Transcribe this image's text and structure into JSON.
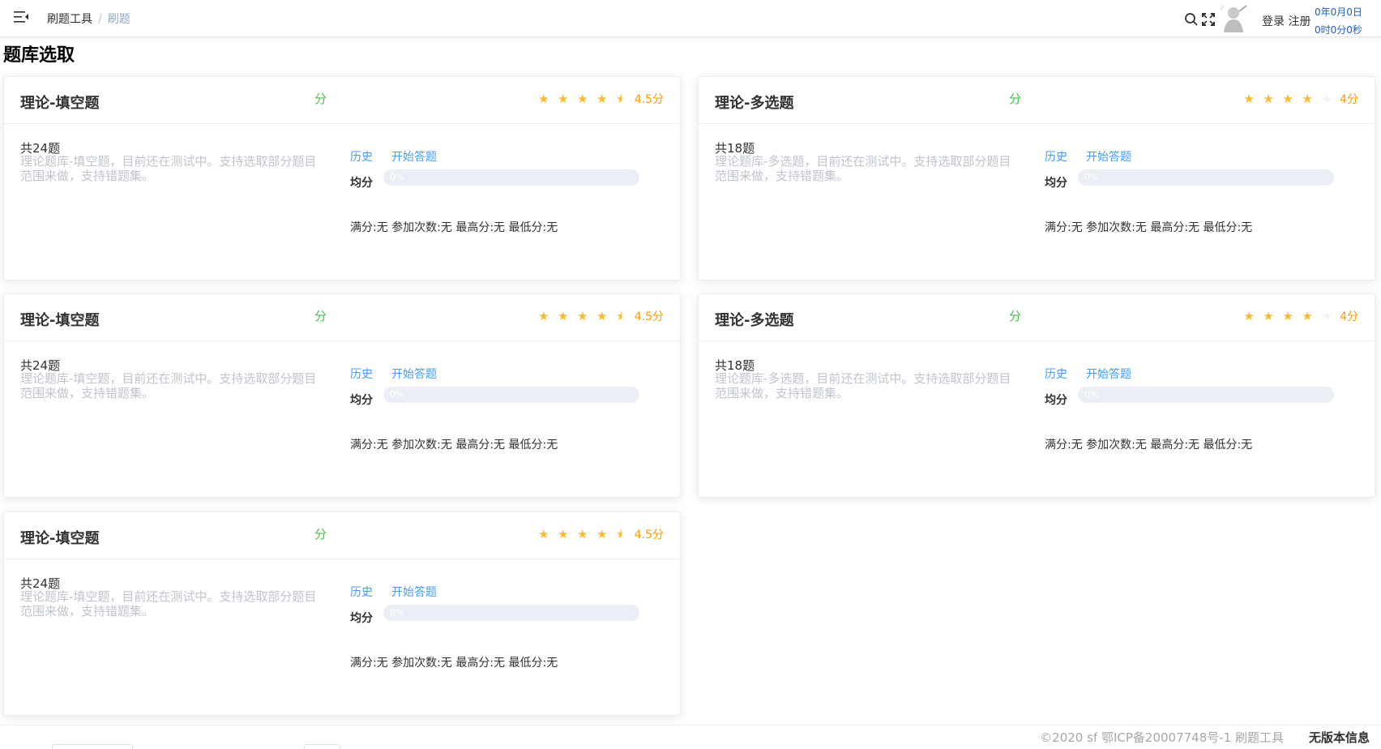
{
  "breadcrumb": {
    "items": [
      "刷题工具",
      "刷题"
    ]
  },
  "header": {
    "auth": {
      "login": "登录",
      "register": "注册"
    },
    "clock": {
      "date": "0年0月0日",
      "time": "0时0分0秒"
    }
  },
  "page": {
    "title": "题库选取"
  },
  "colors": {
    "accent": "#409eff",
    "fen": "#45c14b",
    "star": "#f7ba2a",
    "score": "#ff9900"
  },
  "cards": [
    {
      "title": "理论-填空题",
      "fen": "分",
      "rating": 4.5,
      "score_text": "4.5分",
      "count": "共24题",
      "description": "理论题库-填空题，目前还在测试中。支持选取部分题目范围来做，支持错题集。",
      "history": "历史",
      "start": "开始答题",
      "avg_label": "均分",
      "progress": 0,
      "progress_text": "0%",
      "stats": "满分:无 参加次数:无 最高分:无 最低分:无"
    },
    {
      "title": "理论-多选题",
      "fen": "分",
      "rating": 4,
      "score_text": "4分",
      "count": "共18题",
      "description": "理论题库-多选题，目前还在测试中。支持选取部分题目范围来做，支持错题集。",
      "history": "历史",
      "start": "开始答题",
      "avg_label": "均分",
      "progress": 0,
      "progress_text": "0%",
      "stats": "满分:无 参加次数:无 最高分:无 最低分:无"
    },
    {
      "title": "理论-填空题",
      "fen": "分",
      "rating": 4.5,
      "score_text": "4.5分",
      "count": "共24题",
      "description": "理论题库-填空题，目前还在测试中。支持选取部分题目范围来做，支持错题集。",
      "history": "历史",
      "start": "开始答题",
      "avg_label": "均分",
      "progress": 0,
      "progress_text": "0%",
      "stats": "满分:无 参加次数:无 最高分:无 最低分:无"
    },
    {
      "title": "理论-多选题",
      "fen": "分",
      "rating": 4,
      "score_text": "4分",
      "count": "共18题",
      "description": "理论题库-多选题，目前还在测试中。支持选取部分题目范围来做，支持错题集。",
      "history": "历史",
      "start": "开始答题",
      "avg_label": "均分",
      "progress": 0,
      "progress_text": "0%",
      "stats": "满分:无 参加次数:无 最高分:无 最低分:无"
    },
    {
      "title": "理论-填空题",
      "fen": "分",
      "rating": 4.5,
      "score_text": "4.5分",
      "count": "共24题",
      "description": "理论题库-填空题，目前还在测试中。支持选取部分题目范围来做，支持错题集。",
      "history": "历史",
      "start": "开始答题",
      "avg_label": "均分",
      "progress": 0,
      "progress_text": "0%",
      "stats": "满分:无 参加次数:无 最高分:无 最低分:无"
    }
  ],
  "footer": {
    "copyright": "©2020 sf 鄂ICP备20007748号-1 刷题工具",
    "version": "无版本信息"
  }
}
